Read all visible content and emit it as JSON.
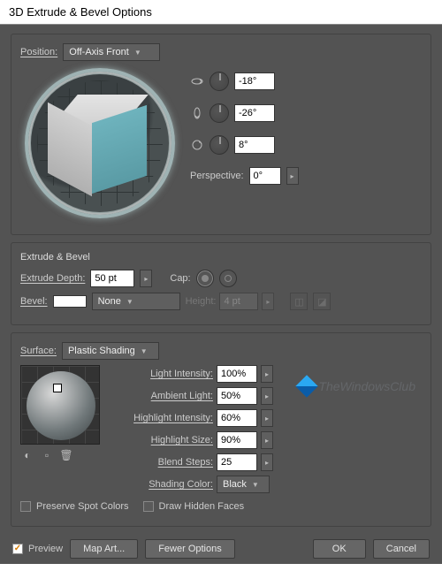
{
  "title": "3D Extrude & Bevel Options",
  "position": {
    "label": "Position:",
    "value": "Off-Axis Front",
    "rotX": "-18°",
    "rotY": "-26°",
    "rotZ": "8°",
    "perspective_label": "Perspective:",
    "perspective": "0°"
  },
  "extrude": {
    "section": "Extrude & Bevel",
    "depth_label": "Extrude Depth:",
    "depth": "50 pt",
    "cap_label": "Cap:",
    "bevel_label": "Bevel:",
    "bevel_value": "None",
    "height_label": "Height:",
    "height": "4 pt"
  },
  "surface": {
    "label": "Surface:",
    "value": "Plastic Shading",
    "light_intensity_label": "Light Intensity:",
    "light_intensity": "100%",
    "ambient_label": "Ambient Light:",
    "ambient": "50%",
    "highlight_intensity_label": "Highlight Intensity:",
    "highlight_intensity": "60%",
    "highlight_size_label": "Highlight Size:",
    "highlight_size": "90%",
    "blend_label": "Blend Steps:",
    "blend": "25",
    "shading_color_label": "Shading Color:",
    "shading_color": "Black",
    "preserve_spot": "Preserve Spot Colors",
    "draw_hidden": "Draw Hidden Faces"
  },
  "footer": {
    "preview": "Preview",
    "map_art": "Map Art...",
    "fewer": "Fewer Options",
    "ok": "OK",
    "cancel": "Cancel"
  },
  "watermark": "TheWindowsClub"
}
